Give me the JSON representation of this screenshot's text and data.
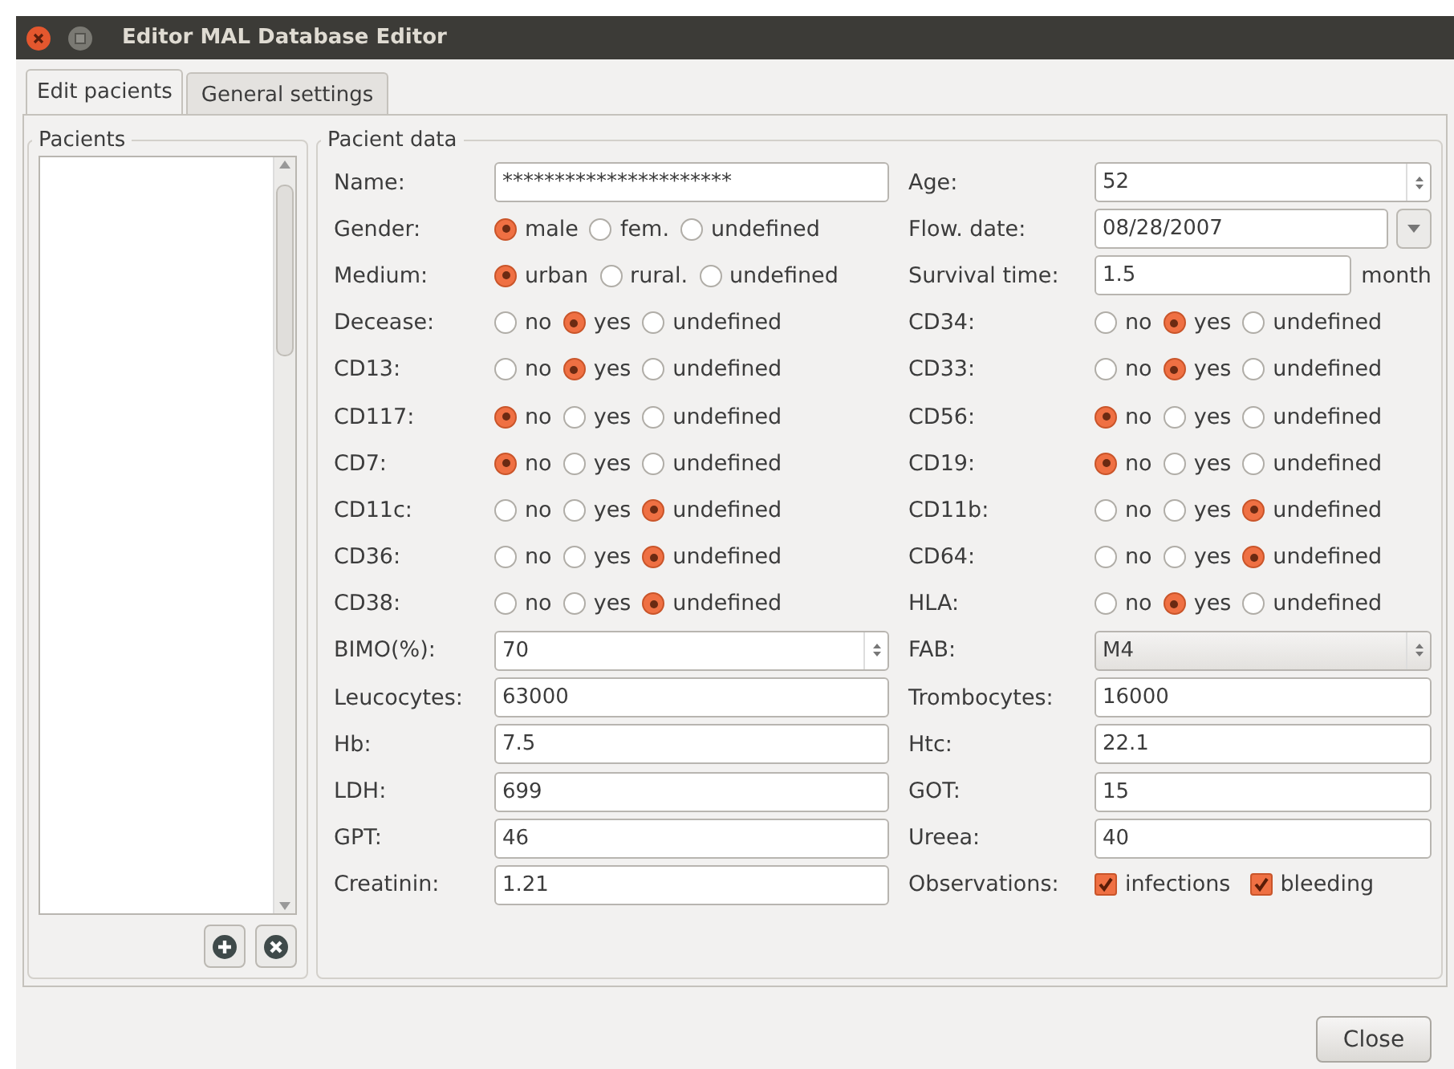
{
  "window": {
    "title": "Editor MAL Database Editor"
  },
  "tabs": [
    {
      "label": "Edit pacients",
      "selected": true
    },
    {
      "label": "General settings",
      "selected": false
    }
  ],
  "patients_panel": {
    "title": "Pacients"
  },
  "data_panel": {
    "title": "Pacient data",
    "left_fields": [
      {
        "kind": "text",
        "label": "Name:",
        "value": "**********************"
      },
      {
        "kind": "radio",
        "label": "Gender:",
        "options": [
          {
            "label": "male",
            "selected": true
          },
          {
            "label": "fem.",
            "selected": false
          },
          {
            "label": "undefined",
            "selected": false
          }
        ]
      },
      {
        "kind": "radio",
        "label": "Medium:",
        "options": [
          {
            "label": "urban",
            "selected": true
          },
          {
            "label": "rural.",
            "selected": false
          },
          {
            "label": "undefined",
            "selected": false
          }
        ]
      },
      {
        "kind": "radio",
        "label": "Decease:",
        "options": [
          {
            "label": "no",
            "selected": false
          },
          {
            "label": "yes",
            "selected": true
          },
          {
            "label": "undefined",
            "selected": false
          }
        ]
      },
      {
        "kind": "radio",
        "label": "CD13:",
        "options": [
          {
            "label": "no",
            "selected": false
          },
          {
            "label": "yes",
            "selected": true
          },
          {
            "label": "undefined",
            "selected": false
          }
        ]
      },
      {
        "kind": "radio",
        "label": "CD117:",
        "options": [
          {
            "label": "no",
            "selected": true
          },
          {
            "label": "yes",
            "selected": false
          },
          {
            "label": "undefined",
            "selected": false
          }
        ]
      },
      {
        "kind": "radio",
        "label": "CD7:",
        "options": [
          {
            "label": "no",
            "selected": true
          },
          {
            "label": "yes",
            "selected": false
          },
          {
            "label": "undefined",
            "selected": false
          }
        ]
      },
      {
        "kind": "radio",
        "label": "CD11c:",
        "options": [
          {
            "label": "no",
            "selected": false
          },
          {
            "label": "yes",
            "selected": false
          },
          {
            "label": "undefined",
            "selected": true
          }
        ]
      },
      {
        "kind": "radio",
        "label": "CD36:",
        "options": [
          {
            "label": "no",
            "selected": false
          },
          {
            "label": "yes",
            "selected": false
          },
          {
            "label": "undefined",
            "selected": true
          }
        ]
      },
      {
        "kind": "radio",
        "label": "CD38:",
        "options": [
          {
            "label": "no",
            "selected": false
          },
          {
            "label": "yes",
            "selected": false
          },
          {
            "label": "undefined",
            "selected": true
          }
        ]
      },
      {
        "kind": "spin",
        "label": "BIMO(%):",
        "value": "70"
      },
      {
        "kind": "text",
        "label": "Leucocytes:",
        "value": "63000"
      },
      {
        "kind": "text",
        "label": "Hb:",
        "value": "7.5"
      },
      {
        "kind": "text",
        "label": "LDH:",
        "value": "699"
      },
      {
        "kind": "text",
        "label": "GPT:",
        "value": "46"
      },
      {
        "kind": "text",
        "label": "Creatinin:",
        "value": "1.21"
      }
    ],
    "right_fields": [
      {
        "kind": "spin",
        "label": "Age:",
        "value": "52"
      },
      {
        "kind": "date",
        "label": "Flow. date:",
        "value": "08/28/2007"
      },
      {
        "kind": "text",
        "label": "Survival time:",
        "value": "1.5",
        "unit": "month"
      },
      {
        "kind": "radio",
        "label": "CD34:",
        "options": [
          {
            "label": "no",
            "selected": false
          },
          {
            "label": "yes",
            "selected": true
          },
          {
            "label": "undefined",
            "selected": false
          }
        ]
      },
      {
        "kind": "radio",
        "label": "CD33:",
        "options": [
          {
            "label": "no",
            "selected": false
          },
          {
            "label": "yes",
            "selected": true
          },
          {
            "label": "undefined",
            "selected": false
          }
        ]
      },
      {
        "kind": "radio",
        "label": "CD56:",
        "options": [
          {
            "label": "no",
            "selected": true
          },
          {
            "label": "yes",
            "selected": false
          },
          {
            "label": "undefined",
            "selected": false
          }
        ]
      },
      {
        "kind": "radio",
        "label": "CD19:",
        "options": [
          {
            "label": "no",
            "selected": true
          },
          {
            "label": "yes",
            "selected": false
          },
          {
            "label": "undefined",
            "selected": false
          }
        ]
      },
      {
        "kind": "radio",
        "label": "CD11b:",
        "options": [
          {
            "label": "no",
            "selected": false
          },
          {
            "label": "yes",
            "selected": false
          },
          {
            "label": "undefined",
            "selected": true
          }
        ]
      },
      {
        "kind": "radio",
        "label": "CD64:",
        "options": [
          {
            "label": "no",
            "selected": false
          },
          {
            "label": "yes",
            "selected": false
          },
          {
            "label": "undefined",
            "selected": true
          }
        ]
      },
      {
        "kind": "radio",
        "label": "HLA:",
        "options": [
          {
            "label": "no",
            "selected": false
          },
          {
            "label": "yes",
            "selected": true
          },
          {
            "label": "undefined",
            "selected": false
          }
        ]
      },
      {
        "kind": "combo",
        "label": "FAB:",
        "value": "M4"
      },
      {
        "kind": "text",
        "label": "Trombocytes:",
        "value": "16000"
      },
      {
        "kind": "text",
        "label": "Htc:",
        "value": "22.1"
      },
      {
        "kind": "text",
        "label": "GOT:",
        "value": "15"
      },
      {
        "kind": "text",
        "label": "Ureea:",
        "value": "40"
      },
      {
        "kind": "checks",
        "label": "Observations:",
        "options": [
          {
            "label": "infections",
            "checked": true
          },
          {
            "label": "bleeding",
            "checked": true
          }
        ]
      }
    ]
  },
  "buttons": [
    {
      "label": "Close"
    }
  ]
}
